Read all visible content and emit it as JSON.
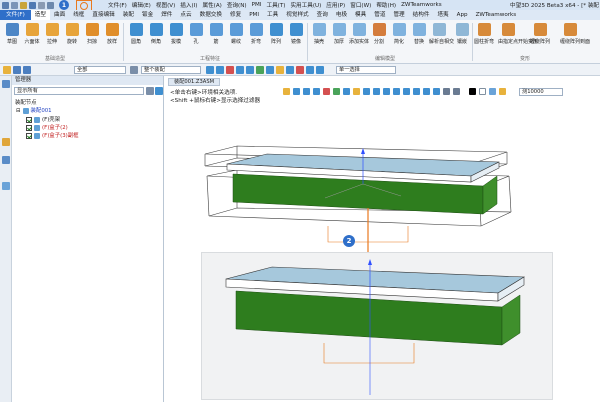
{
  "titlebar": {
    "menus": [
      "文件(F)",
      "编辑(E)",
      "视图(V)",
      "插入(I)",
      "属性(A)",
      "查询(N)",
      "PMI",
      "工具(T)",
      "实用工具(U)",
      "应用(P)",
      "窗口(W)",
      "帮助(H)",
      "ZWTeamworks"
    ],
    "app_title": "中望3D 2025 Beta3 x64 - [* 装配"
  },
  "callouts": {
    "one": "1",
    "two": "2"
  },
  "ribbon_tabs": [
    "文件(F)",
    "造型",
    "曲面",
    "线框",
    "直接编辑",
    "装配",
    "钣金",
    "焊件",
    "点云",
    "数据交换",
    "修复",
    "PMI",
    "工具",
    "视觉样式",
    "查询",
    "电极",
    "模具",
    "管道",
    "管理",
    "结构件",
    "塔夷",
    "App",
    "ZWTeamworks"
  ],
  "ribbon": {
    "buttons": [
      "草图",
      "六面体",
      "拉伸",
      "旋转",
      "扫掠",
      "放样",
      "圆角",
      "倒角",
      "拔模",
      "孔",
      "筋",
      "螺纹",
      "折弯",
      "阵列",
      "镜像",
      "抽壳",
      "加厚",
      "添加实体",
      "分割",
      "简化",
      "替换",
      "解析自相交",
      "镶嵌",
      "圆柱折弯",
      "由指定点开始变形",
      "缠绕阵列",
      "缠绕阵列到面"
    ],
    "groups": [
      "基础造型",
      "工程特征",
      "编辑模型",
      "变形"
    ]
  },
  "toolbar": {
    "filter_value": "全部",
    "scope_value": "整个装配",
    "select_value": "单一选择"
  },
  "manager": {
    "title": "管理器",
    "filter_value": "显示所有",
    "section": "装配节点",
    "tree": [
      {
        "label": "装配001",
        "color": "blue"
      },
      {
        "label": "(F)壳架",
        "color": "black"
      },
      {
        "label": "(F)盒子(2)",
        "color": "red"
      },
      {
        "label": "(F)盒子(3)副框",
        "color": "red"
      }
    ]
  },
  "viewport": {
    "doc_tab": "装配001.Z3ASM",
    "hint1": "<单击右键>环境相关选项.",
    "hint2": "<Shift +鼠标右键>显示选择过滤器",
    "dim_value": "测10000",
    "colors": {
      "box_top": "#a6c8dc",
      "box_side": "#2e7d1e",
      "arrow": "#e8791f",
      "axis": "#3050ff"
    }
  }
}
